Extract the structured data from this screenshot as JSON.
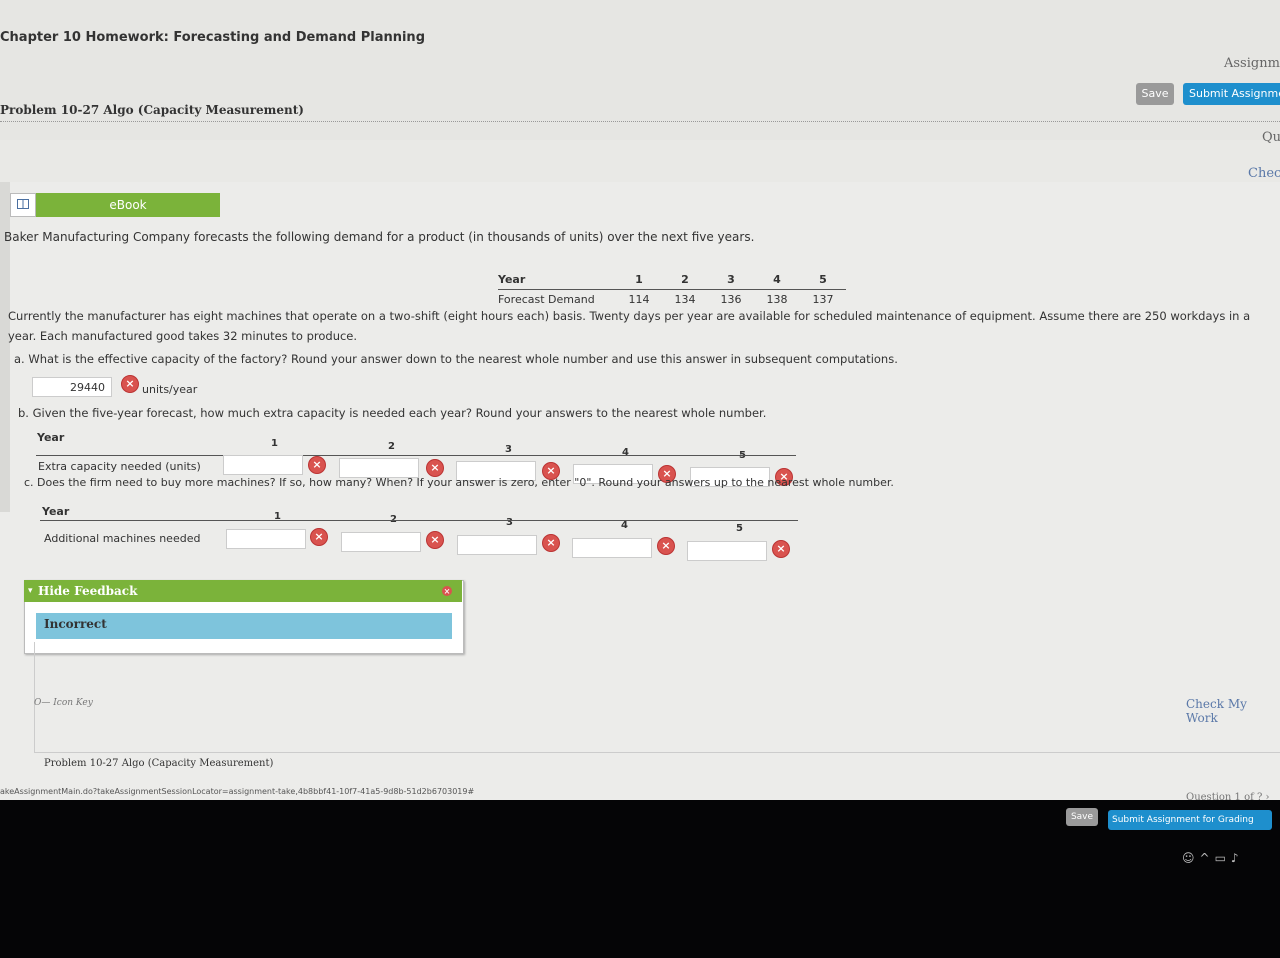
{
  "header": {
    "chapter_title": "Chapter 10 Homework: Forecasting and Demand Planning",
    "assignment_label": "Assignme",
    "save_label": "Save",
    "submit_label": "Submit Assignme",
    "problem_title": "Problem 10-27 Algo (Capacity Measurement)",
    "qu_label": "Qu",
    "check_label": "Chec"
  },
  "ebook": {
    "label": "eBook",
    "icon": "book-icon"
  },
  "intro": "Baker Manufacturing Company forecasts the following demand for a product (in thousands of units) over the next five years.",
  "demand_table": {
    "year_label": "Year",
    "years": [
      "1",
      "2",
      "3",
      "4",
      "5"
    ],
    "forecast_label": "Forecast Demand",
    "forecast": [
      "114",
      "134",
      "136",
      "138",
      "137"
    ]
  },
  "paragraph": "Currently the manufacturer has eight machines that operate on a two-shift (eight hours each) basis. Twenty days per year are available for scheduled maintenance of equipment. Assume there are 250 workdays in a year. Each manufactured good takes 32 minutes to produce.",
  "question_a": {
    "text": "a. What is the effective capacity of the factory? Round your answer down to the nearest whole number and use this answer in subsequent computations.",
    "answer": "29440",
    "unit": "units/year",
    "status_icon": "incorrect-icon"
  },
  "question_b": {
    "text": "b. Given the five-year forecast, how much extra capacity is needed each year? Round your answers to the nearest whole number.",
    "year_label": "Year",
    "years": [
      "1",
      "2",
      "3",
      "4",
      "5"
    ],
    "row_label": "Extra capacity needed (units)"
  },
  "question_c": {
    "text": "c. Does the firm need to buy more machines? If so, how many? When? If your answer is zero, enter \"0\". Round your answers up to the nearest whole number.",
    "year_label": "Year",
    "years": [
      "1",
      "2",
      "3",
      "4",
      "5"
    ],
    "row_label": "Additional machines needed"
  },
  "feedback": {
    "toggle_label": "Hide Feedback",
    "caret": "▾",
    "close": "×",
    "status": "Incorrect"
  },
  "footer": {
    "icon_key": "O— Icon Key",
    "check_my_work": "Check My Work",
    "problem_title": "Problem 10-27 Algo (Capacity Measurement)",
    "url": "akeAssignmentMain.do?takeAssignmentSessionLocator=assignment-take,4b8bbf41-10f7-41a5-9d8b-51d2b6703019#",
    "question_nav": "Question 1 of ? ›",
    "save_label": "Save",
    "submit_label": "Submit Assignment for Grading"
  },
  "system_tray": {
    "icons": [
      "people-icon",
      "chevron-up-icon",
      "network-icon",
      "volume-icon"
    ]
  },
  "colors": {
    "green": "#7bb33a",
    "blue": "#1e8fcd",
    "error_red": "#d9534f",
    "feedback_blue": "#7ec4dc"
  }
}
